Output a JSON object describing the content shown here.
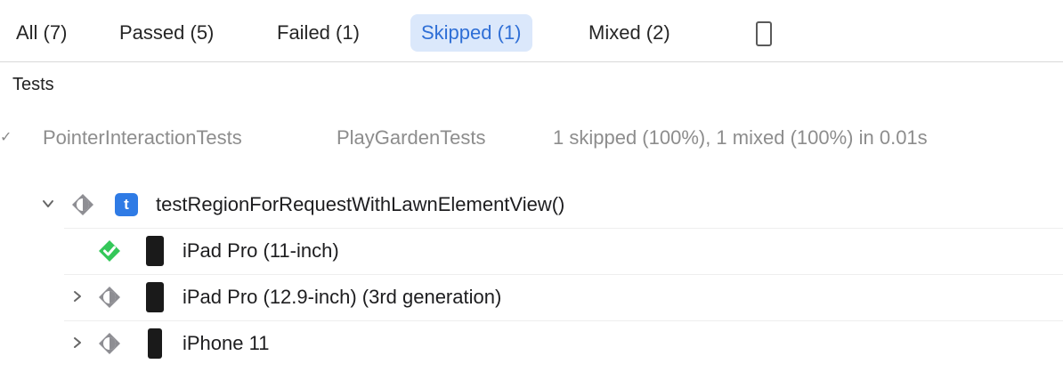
{
  "filters": [
    {
      "label": "All (7)",
      "active": false
    },
    {
      "label": "Passed (5)",
      "active": false
    },
    {
      "label": "Failed (1)",
      "active": false
    },
    {
      "label": "Skipped (1)",
      "active": true
    },
    {
      "label": "Mixed (2)",
      "active": false
    }
  ],
  "filter_device_icon": "iphone-icon",
  "section_title": "Tests",
  "suite": {
    "breadcrumb": [
      "PointerInteractionTests",
      "PlayGardenTests"
    ],
    "summary": "1 skipped (100%), 1 mixed (100%) in 0.01s"
  },
  "test": {
    "name": "testRegionForRequestWithLawnElementView()",
    "badge": "t",
    "status": "mixed",
    "expanded": true
  },
  "runs": [
    {
      "device": "iPad Pro (11-inch)",
      "status": "passed",
      "device_icon": "ipad-icon",
      "expandable": false
    },
    {
      "device": "iPad Pro (12.9-inch) (3rd generation)",
      "status": "mixed",
      "device_icon": "ipad-icon",
      "expandable": true
    },
    {
      "device": "iPhone 11",
      "status": "mixed",
      "device_icon": "iphone-icon",
      "expandable": true
    }
  ],
  "colors": {
    "accent": "#2f6fd6",
    "active_filter_bg": "#dbe8fb",
    "passed": "#34c759",
    "mixed": "#8e8e93",
    "badge": "#2f7be5"
  }
}
